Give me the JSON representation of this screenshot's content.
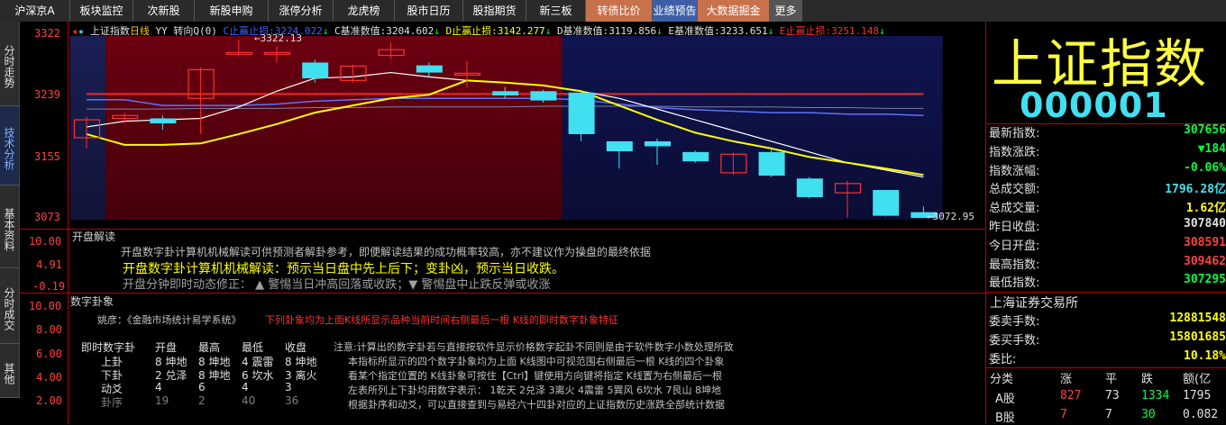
{
  "nav": {
    "tabs": [
      "沪深京A",
      "板块监控",
      "次新股",
      "新股申购",
      "涨停分析",
      "龙虎榜",
      "股市日历",
      "股指期货",
      "新三板",
      "转债比价",
      "业绩预告",
      "大数据掘金",
      "更多"
    ]
  },
  "side_tabs": [
    "分时走势",
    "技术分析",
    "基本资料",
    "分时成交",
    "其他"
  ],
  "chart_header": {
    "name": "上证指数",
    "period": "日线",
    "mode": "YY 转向Q(0)",
    "c_label": "C止赢止损:",
    "c_value": "3224.022",
    "c2_label": "C基准数值:",
    "c2_value": "3204.602",
    "d_label": "D止赢止损:",
    "d_value": "3142.277",
    "d2_label": "D基准数值:",
    "d2_value": "3119.856",
    "e2_label": "E基准数值:",
    "e2_value": "3233.651",
    "e_label": "E止赢止损:",
    "e_value": "3251.148"
  },
  "axis": {
    "price_ticks": [
      "3322",
      "3239",
      "3155",
      "3073"
    ],
    "panel2_ticks": [
      "10.00",
      "4.91",
      "-0.19"
    ],
    "panel3_ticks": [
      "10.00",
      "8.00",
      "6.00",
      "4.00",
      "2.00"
    ],
    "high_label": "3322.13",
    "low_label": "3072.95"
  },
  "colors": {
    "up": "#ff3030",
    "down": "#40e0f0",
    "ma1": "#ffff00",
    "ma2": "#ffffff",
    "accent": "#c8724c"
  },
  "chart_data": {
    "type": "candlestick",
    "title": "上证指数",
    "ylim": [
      3073,
      3322
    ],
    "candles": [
      {
        "o": 3185,
        "c": 3210,
        "h": 3214,
        "l": 3170
      },
      {
        "o": 3212,
        "c": 3216,
        "h": 3220,
        "l": 3205
      },
      {
        "o": 3212,
        "c": 3205,
        "h": 3216,
        "l": 3196
      },
      {
        "o": 3240,
        "c": 3280,
        "h": 3283,
        "l": 3190
      },
      {
        "o": 3302,
        "c": 3304,
        "h": 3322,
        "l": 3300
      },
      {
        "o": 3302,
        "c": 3304,
        "h": 3312,
        "l": 3290
      },
      {
        "o": 3290,
        "c": 3268,
        "h": 3294,
        "l": 3262
      },
      {
        "o": 3265,
        "c": 3285,
        "h": 3287,
        "l": 3262
      },
      {
        "o": 3300,
        "c": 3308,
        "h": 3318,
        "l": 3295
      },
      {
        "o": 3286,
        "c": 3276,
        "h": 3290,
        "l": 3270
      },
      {
        "o": 3273,
        "c": 3275,
        "h": 3292,
        "l": 3255
      },
      {
        "o": 3250,
        "c": 3244,
        "h": 3256,
        "l": 3240
      },
      {
        "o": 3250,
        "c": 3237,
        "h": 3252,
        "l": 3234
      },
      {
        "o": 3248,
        "c": 3190,
        "h": 3250,
        "l": 3180
      },
      {
        "o": 3180,
        "c": 3166,
        "h": 3180,
        "l": 3142
      },
      {
        "o": 3180,
        "c": 3173,
        "h": 3184,
        "l": 3147
      },
      {
        "o": 3165,
        "c": 3152,
        "h": 3167,
        "l": 3150
      },
      {
        "o": 3136,
        "c": 3162,
        "h": 3164,
        "l": 3133
      },
      {
        "o": 3165,
        "c": 3132,
        "h": 3172,
        "l": 3130
      },
      {
        "o": 3128,
        "c": 3102,
        "h": 3130,
        "l": 3100
      },
      {
        "o": 3108,
        "c": 3121,
        "h": 3125,
        "l": 3073
      },
      {
        "o": 3112,
        "c": 3076,
        "h": 3112,
        "l": 3075
      },
      {
        "o": 3081,
        "c": 3073,
        "h": 3089,
        "l": 3073
      }
    ],
    "ma_yellow": [
      3190,
      3175,
      3175,
      3177,
      3190,
      3204,
      3220,
      3230,
      3240,
      3245,
      3265,
      3262,
      3258,
      3250,
      3230,
      3210,
      3192,
      3180,
      3170,
      3158,
      3150,
      3142,
      3133
    ],
    "ma_white": [
      3200,
      3208,
      3210,
      3212,
      3228,
      3250,
      3268,
      3270,
      3276,
      3270,
      3265,
      3262,
      3258,
      3250,
      3240,
      3225,
      3210,
      3195,
      3180,
      3165,
      3150,
      3140,
      3130
    ],
    "ma_blue": [
      3238,
      3238,
      3230,
      3230,
      3230,
      3232,
      3236,
      3238,
      3240,
      3240,
      3240,
      3240,
      3240,
      3238,
      3232,
      3227,
      3224,
      3222,
      3220,
      3220,
      3218,
      3218,
      3216
    ],
    "ma_gray": [
      3225,
      3225,
      3225,
      3226,
      3226,
      3226,
      3227,
      3227,
      3228,
      3228,
      3228,
      3228,
      3229,
      3229,
      3229,
      3229,
      3228,
      3228,
      3228,
      3227,
      3227,
      3226,
      3226
    ],
    "ma_red": [
      3246,
      3246,
      3246,
      3246,
      3246,
      3246,
      3246,
      3246,
      3246,
      3246,
      3246,
      3246,
      3246,
      3246,
      3246,
      3246,
      3246,
      3246,
      3246,
      3246,
      3246,
      3246,
      3246
    ],
    "bg_segments": [
      {
        "from": 0,
        "to": 1,
        "color": "#1a1f55"
      },
      {
        "from": 1,
        "to": 13,
        "color": "#6a0010"
      },
      {
        "from": 13,
        "to": 23,
        "color": "#101450"
      }
    ]
  },
  "panel_kaipan": {
    "title": "开盘解读",
    "line1": "开盘数字卦计算机机械解读可供预测者解卦参考，即便解读结果的成功概率较高，亦不建议作为操盘的最终依据",
    "line2": "开盘数字卦计算机机械解读：预示当日盘中先上后下；变卦凶，预示当日收跌。",
    "line3": "开盘分钟即时动态修正：  ▲ 警惕当日冲高回落或收跌；▼ 警惕盘中止跌反弹或收涨"
  },
  "panel_gua": {
    "title": "数字卦象",
    "subtitle_label": "姚彦：《金融市场统计易学系统》",
    "subtitle_red": "下列卦象均为上面K线所显示品种当前时间右侧最后一根 K线的即时数字卦象特征",
    "table_header": [
      "即时数字卦",
      "开盘",
      "最高",
      "最低",
      "收盘"
    ],
    "rows": [
      {
        "name": "上卦",
        "c": [
          "8 坤地",
          "8 坤地",
          "4 震雷",
          "8 坤地"
        ]
      },
      {
        "name": "下卦",
        "c": [
          "2 兑泽",
          "8 坤地",
          "6 坎水",
          "3 离火"
        ]
      },
      {
        "name": "动爻",
        "c": [
          "4",
          "6",
          "4",
          "3"
        ]
      },
      {
        "name": "卦序",
        "c": [
          "19",
          "2",
          "40",
          "36"
        ]
      }
    ],
    "notes": [
      "注意:计算出的数字卦若与直接按软件显示价格数字起卦不同则是由于软件数字小数处理所致",
      "本指标所显示的四个数字卦象均为上面 K线图中可视范围右侧最后一根 K线的四个卦象",
      "看某个指定位置的 K线卦象可按住【Ctrl】键使用方向键将指定 K线置为右侧最后一根",
      "左表所列上下卦均用数字表示： 1乾天 2兑泽 3离火 4震雷 5巽风 6坎水 7艮山 8坤地",
      "根据卦序和动爻，可以直接查到与易经六十四卦对应的上证指数历史涨跌全部统计数据"
    ]
  },
  "right_panel": {
    "big_title": "上证指数",
    "code": "000001",
    "rows": [
      {
        "label": "最新指数:",
        "value": "307656",
        "color": "#00ff40"
      },
      {
        "label": "指数涨跌:",
        "value": "▼184",
        "color": "#00ff40"
      },
      {
        "label": "指数涨幅:",
        "value": "-0.06%",
        "color": "#00ff40"
      },
      {
        "label": "总成交额:",
        "value": "1796.28亿",
        "color": "#40e0f0"
      },
      {
        "label": "总成交量:",
        "value": "1.62亿",
        "color": "#ffff00"
      },
      {
        "label": "昨日收盘:",
        "value": "307840",
        "color": "#e0e0e0"
      },
      {
        "label": "今日开盘:",
        "value": "308591",
        "color": "#ff4040"
      },
      {
        "label": "最高指数:",
        "value": "309462",
        "color": "#ff4040"
      },
      {
        "label": "最低指数:",
        "value": "307295",
        "color": "#00ff40"
      }
    ],
    "exchange": "上海证券交易所",
    "rows2": [
      {
        "label": "委卖手数:",
        "value": "12881548",
        "color": "#ffff00"
      },
      {
        "label": "委买手数:",
        "value": "15801685",
        "color": "#ffff00"
      },
      {
        "label": "委比:",
        "value": "10.18%",
        "color": "#ffff00"
      }
    ],
    "table_header": [
      "分类",
      "涨",
      "平",
      "跌",
      "额(亿"
    ],
    "table_rows": [
      {
        "cls": "A股",
        "up": "827",
        "flat": "73",
        "down": "1334",
        "amt": "1795"
      },
      {
        "cls": "B股",
        "up": "7",
        "flat": "7",
        "down": "30",
        "amt": "0.082"
      }
    ]
  }
}
